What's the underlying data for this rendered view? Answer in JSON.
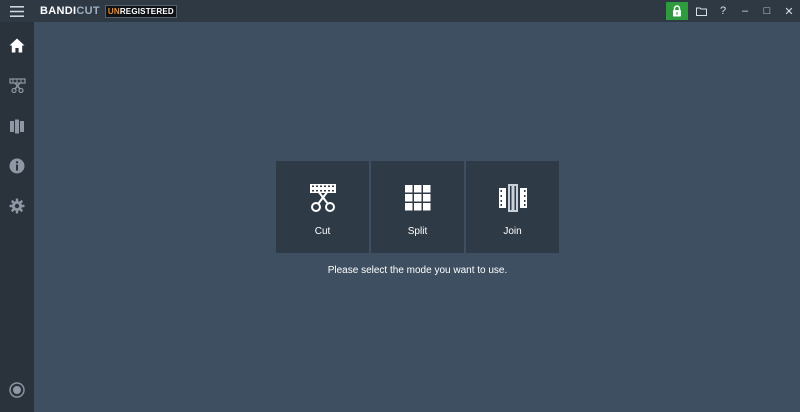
{
  "app": {
    "logo_part1": "BANDI",
    "logo_part2": "CUT",
    "badge_un": "UN",
    "badge_rest": "REGISTERED"
  },
  "title_controls": {
    "help": "?",
    "minimize": "–",
    "maximize": "□",
    "close": "✕"
  },
  "modes": [
    {
      "label": "Cut"
    },
    {
      "label": "Split"
    },
    {
      "label": "Join"
    }
  ],
  "hint": "Please select the mode you want to use.",
  "colors": {
    "background": "#3f4f62",
    "sidebar": "#2a323c",
    "titlebar": "#2f3944",
    "tile": "#2f3a47",
    "lock": "#2e9b3e",
    "unregistered": "#f08a25"
  },
  "icons": {
    "menu": "hamburger-menu-icon",
    "home": "home-icon",
    "cut": "scissors-filmstrip-icon",
    "join": "join-filmstrip-icon",
    "info": "info-icon",
    "settings": "gear-icon",
    "record": "record-icon",
    "lock": "lock-icon",
    "folder": "folder-icon"
  }
}
